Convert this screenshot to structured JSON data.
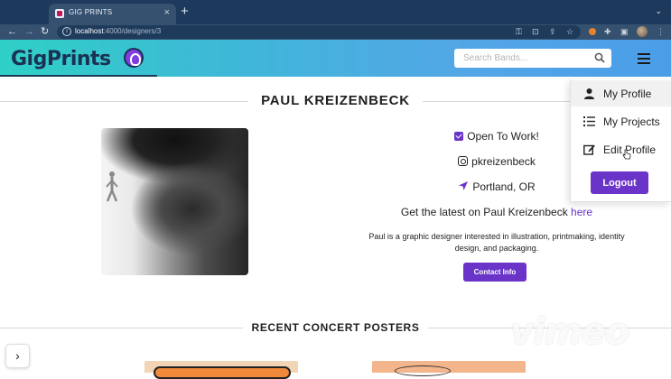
{
  "browser": {
    "tab_title": "GIG PRINTS",
    "url_host": "localhost",
    "url_rest": ":4000/designers/3"
  },
  "header": {
    "logo_text": "GigPrints",
    "search_placeholder": "Search Bands..."
  },
  "menu": {
    "items": [
      {
        "label": "My Profile",
        "icon": "user-icon"
      },
      {
        "label": "My Projects",
        "icon": "list-icon"
      },
      {
        "label": "Edit Profile",
        "icon": "edit-icon"
      }
    ],
    "logout_label": "Logout"
  },
  "profile": {
    "name": "PAUL KREIZENBECK",
    "open_to_work": "Open To Work!",
    "instagram": "pkreizenbeck",
    "location": "Portland, OR",
    "latest_prefix": "Get the latest on Paul Kreizenbeck",
    "latest_link": "here",
    "bio": "Paul is a graphic designer interested in illustration, printmaking, identity design, and packaging.",
    "contact_label": "Contact Info"
  },
  "posters": {
    "section_title": "RECENT CONCERT POSTERS"
  },
  "overlay": {
    "watermark": "vimeo"
  },
  "colors": {
    "accent": "#6a34c9",
    "header_start": "#2fd0c6",
    "header_end": "#4a9ee8",
    "logo": "#1a3152"
  }
}
